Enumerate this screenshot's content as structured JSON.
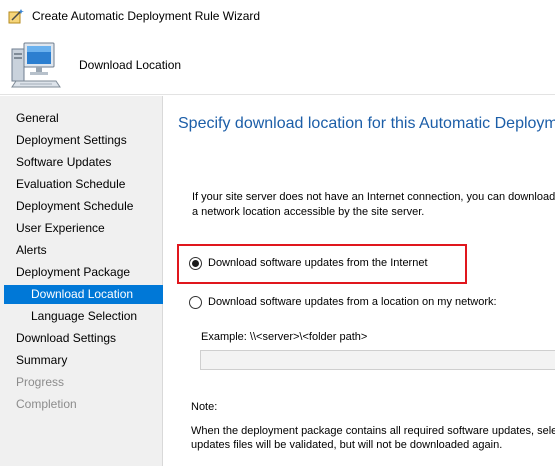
{
  "window": {
    "title": "Create Automatic Deployment Rule Wizard"
  },
  "header": {
    "page_name": "Download Location"
  },
  "sidebar": {
    "items": [
      {
        "label": "General",
        "state": "normal"
      },
      {
        "label": "Deployment Settings",
        "state": "normal"
      },
      {
        "label": "Software Updates",
        "state": "normal"
      },
      {
        "label": "Evaluation Schedule",
        "state": "normal"
      },
      {
        "label": "Deployment Schedule",
        "state": "normal"
      },
      {
        "label": "User Experience",
        "state": "normal"
      },
      {
        "label": "Alerts",
        "state": "normal"
      },
      {
        "label": "Deployment Package",
        "state": "normal"
      },
      {
        "label": "Download Location",
        "state": "selected"
      },
      {
        "label": "Language Selection",
        "state": "normal"
      },
      {
        "label": "Download Settings",
        "state": "normal"
      },
      {
        "label": "Summary",
        "state": "normal"
      },
      {
        "label": "Progress",
        "state": "disabled"
      },
      {
        "label": "Completion",
        "state": "disabled"
      }
    ]
  },
  "main": {
    "heading": "Specify download location for this Automatic Deploym",
    "description_line1": "If your site server does not have an Internet connection, you can download th",
    "description_line2": "a network location accessible by the site server.",
    "option_internet": {
      "label": "Download software updates from the Internet",
      "selected": true
    },
    "option_network": {
      "label": "Download software updates from a location on my network:",
      "selected": false
    },
    "example_label": "Example: \\\\<server>\\<folder path>",
    "path_value": "",
    "note_title": "Note:",
    "note_line1": "When the deployment package contains all required software updates, select",
    "note_line2": "updates files will be validated, but will not be downloaded again."
  },
  "colors": {
    "accent": "#0078d7",
    "heading": "#1c5ea8",
    "highlight_border": "#e0161d",
    "sidebar_bg": "#f0f0f0",
    "disabled_text": "#8c8c8c"
  },
  "icons": {
    "title": "wizard-icon",
    "header": "computer-icon"
  }
}
